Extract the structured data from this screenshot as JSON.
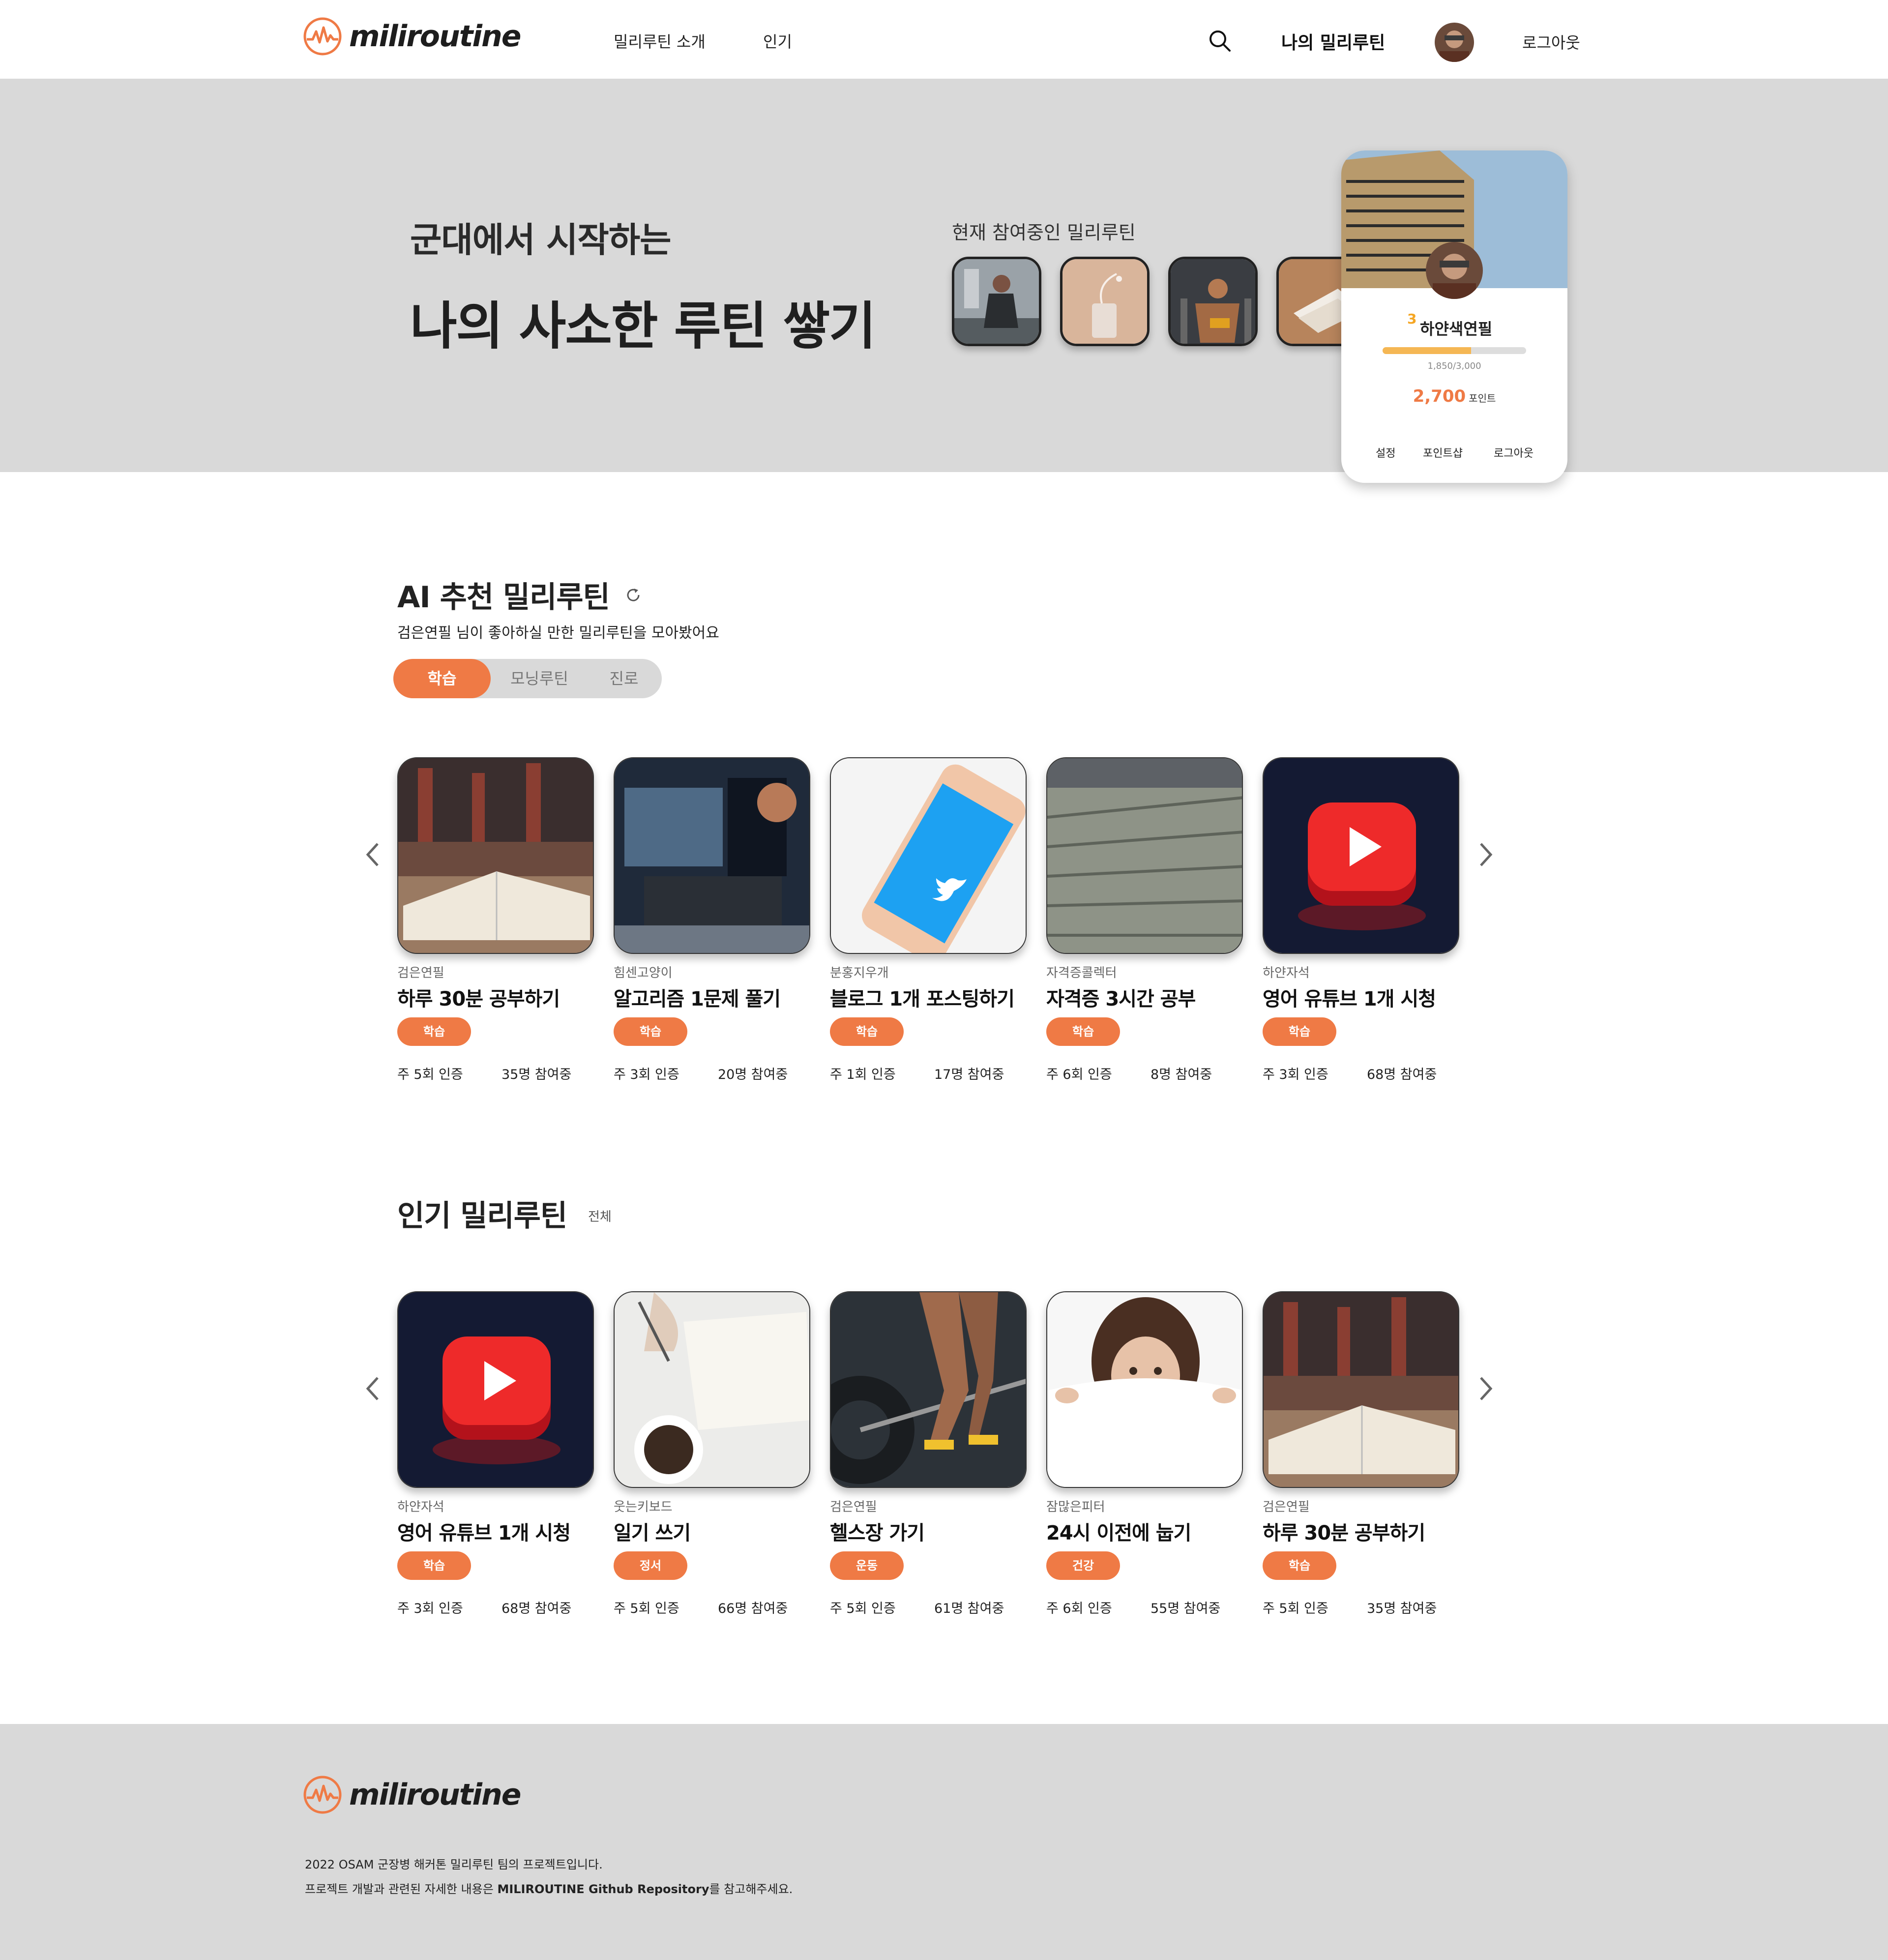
{
  "brand": {
    "name": "miliroutine",
    "accent": "#ef7a45",
    "logo_icon": "mountain-pulse-icon"
  },
  "nav": {
    "intro": "밀리루틴 소개",
    "popular": "인기",
    "search_icon": "search-icon",
    "my": "나의 밀리루틴",
    "logout": "로그아웃"
  },
  "hero": {
    "subtitle": "군대에서 시작하는",
    "title": "나의 사소한 루틴 쌓기",
    "current_label": "현재 참여중인 밀리루틴"
  },
  "profile": {
    "level": "3",
    "username": "하얀색연필",
    "xp": "1,850/3,000",
    "xp_fraction": 0.617,
    "points": "2,700",
    "points_unit": "포인트",
    "menu": [
      "설정",
      "포인트샵",
      "로그아웃"
    ]
  },
  "ai_section": {
    "title": "AI 추천 밀리루틴",
    "refresh_icon": "refresh-icon",
    "desc": "검은연필 님이 좋아하실 만한 밀리루틴을 모아봤어요",
    "tabs": [
      "학습",
      "모닝루틴",
      "진로"
    ],
    "cards": [
      {
        "author": "검은연필",
        "title": "하루 30분 공부하기",
        "category": "학습",
        "freq": "주 5회 인증",
        "participants": "35명 참여중"
      },
      {
        "author": "힘센고양이",
        "title": "알고리즘 1문제 풀기",
        "category": "학습",
        "freq": "주 3회 인증",
        "participants": "20명 참여중"
      },
      {
        "author": "분홍지우개",
        "title": "블로그 1개 포스팅하기",
        "category": "학습",
        "freq": "주 1회 인증",
        "participants": "17명 참여중"
      },
      {
        "author": "자격증콜렉터",
        "title": "자격증 3시간 공부",
        "category": "학습",
        "freq": "주 6회 인증",
        "participants": "8명 참여중"
      },
      {
        "author": "하얀자석",
        "title": "영어 유튜브 1개 시청",
        "category": "학습",
        "freq": "주 3회 인증",
        "participants": "68명 참여중"
      }
    ]
  },
  "popular_section": {
    "title": "인기 밀리루틴",
    "view_all": "전체",
    "cards": [
      {
        "author": "하얀자석",
        "title": "영어 유튜브 1개 시청",
        "category": "학습",
        "freq": "주 3회 인증",
        "participants": "68명 참여중"
      },
      {
        "author": "웃는키보드",
        "title": "일기 쓰기",
        "category": "정서",
        "freq": "주 5회 인증",
        "participants": "66명 참여중"
      },
      {
        "author": "검은연필",
        "title": "헬스장 가기",
        "category": "운동",
        "freq": "주 5회 인증",
        "participants": "61명 참여중"
      },
      {
        "author": "잠많은피터",
        "title": "24시 이전에 눕기",
        "category": "건강",
        "freq": "주 6회 인증",
        "participants": "55명 참여중"
      },
      {
        "author": "검은연필",
        "title": "하루 30분 공부하기",
        "category": "학습",
        "freq": "주 5회 인증",
        "participants": "35명 참여중"
      }
    ]
  },
  "footer": {
    "line1": "2022 OSAM 군장병 해커톤 밀리루틴 팀의 프로젝트입니다.",
    "line2_pre": "프로젝트 개발과 관련된 자세한 내용은 ",
    "line2_bold": "MILIROUTINE Github Repository",
    "line2_post": "를 참고해주세요."
  }
}
